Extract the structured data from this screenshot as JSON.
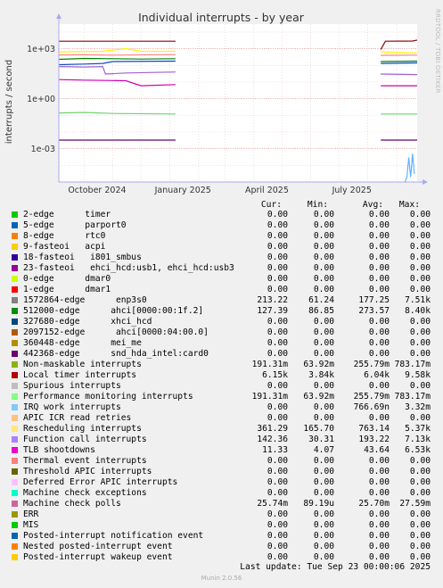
{
  "side_note": "RRDTOOL / TOBI OETIKER",
  "footer": {
    "last_update": "Last update: Tue Sep 23 00:00:06 2025",
    "version": "Munin 2.0.56"
  },
  "chart_data": {
    "type": "line",
    "title": "Individual interrupts - by year",
    "ylabel": "interrupts / second",
    "yscale": "log",
    "ylim": [
      1e-05,
      30000
    ],
    "yticks": [
      {
        "value": 0.001,
        "label": "1e-03"
      },
      {
        "value": 1,
        "label": "1e+00"
      },
      {
        "value": 1000,
        "label": "1e+03"
      }
    ],
    "xlim": [
      "2024-09-04",
      "2025-09-23"
    ],
    "xticks": [
      {
        "date": "2024-10-15",
        "label": "October 2024"
      },
      {
        "date": "2025-01-15",
        "label": "January 2025"
      },
      {
        "date": "2025-04-15",
        "label": "April 2025"
      },
      {
        "date": "2025-07-15",
        "label": "July 2025"
      }
    ],
    "grid": true,
    "series": [
      {
        "color": "#8b0000",
        "segments": [
          [
            [
              "2024-09-04",
              2800
            ],
            [
              "2025-01-07",
              2800
            ]
          ],
          [
            [
              "2025-08-15",
              900
            ],
            [
              "2025-08-20",
              2800
            ],
            [
              "2025-09-18",
              2900
            ],
            [
              "2025-09-23",
              3300
            ]
          ]
        ]
      },
      {
        "color": "#fff200",
        "segments": [
          [
            [
              "2024-09-04",
              650
            ],
            [
              "2024-10-20",
              700
            ],
            [
              "2024-11-15",
              1000
            ],
            [
              "2024-12-01",
              720
            ],
            [
              "2025-01-07",
              700
            ]
          ],
          [
            [
              "2025-08-15",
              650
            ],
            [
              "2025-09-23",
              560
            ]
          ]
        ]
      },
      {
        "color": "#ff7f7f",
        "segments": [
          [
            [
              "2024-09-04",
              420
            ],
            [
              "2024-10-01",
              430
            ],
            [
              "2024-11-01",
              410
            ],
            [
              "2025-01-07",
              440
            ]
          ],
          [
            [
              "2025-08-15",
              400
            ],
            [
              "2025-09-23",
              410
            ]
          ]
        ]
      },
      {
        "color": "#008000",
        "segments": [
          [
            [
              "2024-09-04",
              230
            ],
            [
              "2024-10-01",
              260
            ],
            [
              "2024-11-01",
              250
            ],
            [
              "2024-12-01",
              240
            ],
            [
              "2025-01-07",
              250
            ]
          ],
          [
            [
              "2025-08-15",
              170
            ],
            [
              "2025-09-23",
              180
            ]
          ]
        ]
      },
      {
        "color": "#0d4bb8",
        "segments": [
          [
            [
              "2024-09-04",
              110
            ],
            [
              "2024-10-01",
              120
            ],
            [
              "2024-10-21",
              130
            ],
            [
              "2024-10-24",
              140
            ],
            [
              "2024-11-01",
              170
            ],
            [
              "2025-01-07",
              180
            ]
          ],
          [
            [
              "2025-08-15",
              130
            ],
            [
              "2025-09-23",
              140
            ]
          ]
        ]
      },
      {
        "color": "#a05fd0",
        "segments": [
          [
            [
              "2024-09-04",
              85
            ],
            [
              "2024-10-01",
              80
            ],
            [
              "2024-10-21",
              85
            ],
            [
              "2024-10-24",
              30
            ],
            [
              "2024-11-15",
              35
            ],
            [
              "2025-01-07",
              40
            ]
          ],
          [
            [
              "2025-08-15",
              30
            ],
            [
              "2025-09-23",
              28
            ]
          ]
        ]
      },
      {
        "color": "#cc00aa",
        "segments": [
          [
            [
              "2024-09-04",
              14
            ],
            [
              "2024-10-01",
              13
            ],
            [
              "2024-11-15",
              12
            ],
            [
              "2024-12-01",
              6
            ],
            [
              "2025-01-07",
              7
            ]
          ],
          [
            [
              "2025-08-15",
              6
            ],
            [
              "2025-09-23",
              6
            ]
          ]
        ]
      },
      {
        "color": "#6fd16f",
        "segments": [
          [
            [
              "2024-09-04",
              0.14
            ],
            [
              "2024-10-01",
              0.15
            ],
            [
              "2024-11-01",
              0.13
            ],
            [
              "2025-01-07",
              0.12
            ]
          ],
          [
            [
              "2025-08-15",
              0.12
            ],
            [
              "2025-09-23",
              0.12
            ]
          ]
        ]
      },
      {
        "color": "#6b006b",
        "segments": [
          [
            [
              "2024-09-04",
              0.0033
            ],
            [
              "2025-01-07",
              0.0033
            ]
          ],
          [
            [
              "2025-08-15",
              0.0033
            ],
            [
              "2025-09-23",
              0.0033
            ]
          ]
        ]
      },
      {
        "color": "#5fb3ff",
        "segments": [
          [
            [
              "2025-09-10",
              1e-05
            ],
            [
              "2025-09-12",
              2e-05
            ],
            [
              "2025-09-14",
              0.0003
            ],
            [
              "2025-09-16",
              2e-05
            ],
            [
              "2025-09-18",
              0.0005
            ],
            [
              "2025-09-20",
              3e-05
            ]
          ]
        ]
      }
    ],
    "legend_headers": {
      "cur": "Cur:",
      "min": "Min:",
      "avg": "Avg:",
      "max": "Max:"
    },
    "legend": [
      {
        "name": "2-edge      timer",
        "color": "#00cc00",
        "cur": "0.00",
        "min": "0.00",
        "avg": "0.00",
        "max": "0.00"
      },
      {
        "name": "5-edge      parport0",
        "color": "#0066b3",
        "cur": "0.00",
        "min": "0.00",
        "avg": "0.00",
        "max": "0.00"
      },
      {
        "name": "8-edge      rtc0",
        "color": "#ff8000",
        "cur": "0.00",
        "min": "0.00",
        "avg": "0.00",
        "max": "0.00"
      },
      {
        "name": "9-fasteoi   acpi",
        "color": "#ffcc00",
        "cur": "0.00",
        "min": "0.00",
        "avg": "0.00",
        "max": "0.00"
      },
      {
        "name": "18-fasteoi   i801_smbus",
        "color": "#330099",
        "cur": "0.00",
        "min": "0.00",
        "avg": "0.00",
        "max": "0.00"
      },
      {
        "name": "23-fasteoi   ehci_hcd:usb1, ehci_hcd:usb3",
        "color": "#990099",
        "cur": "0.00",
        "min": "0.00",
        "avg": "0.00",
        "max": "0.00"
      },
      {
        "name": "0-edge      dmar0",
        "color": "#ccff00",
        "cur": "0.00",
        "min": "0.00",
        "avg": "0.00",
        "max": "0.00"
      },
      {
        "name": "1-edge      dmar1",
        "color": "#ff0000",
        "cur": "0.00",
        "min": "0.00",
        "avg": "0.00",
        "max": "0.00"
      },
      {
        "name": "1572864-edge      enp3s0",
        "color": "#808080",
        "cur": "213.22",
        "min": "61.24",
        "avg": "177.25",
        "max": "7.51k"
      },
      {
        "name": "512000-edge      ahci[0000:00:1f.2]",
        "color": "#008f00",
        "cur": "127.39",
        "min": "86.85",
        "avg": "273.57",
        "max": "8.40k"
      },
      {
        "name": "327680-edge      xhci_hcd",
        "color": "#00487d",
        "cur": "0.00",
        "min": "0.00",
        "avg": "0.00",
        "max": "0.00"
      },
      {
        "name": "2097152-edge      ahci[0000:04:00.0]",
        "color": "#b35a00",
        "cur": "0.00",
        "min": "0.00",
        "avg": "0.00",
        "max": "0.00"
      },
      {
        "name": "360448-edge      mei_me",
        "color": "#b38f00",
        "cur": "0.00",
        "min": "0.00",
        "avg": "0.00",
        "max": "0.00"
      },
      {
        "name": "442368-edge      snd_hda_intel:card0",
        "color": "#6b006b",
        "cur": "0.00",
        "min": "0.00",
        "avg": "0.00",
        "max": "0.00"
      },
      {
        "name": "Non-maskable interrupts",
        "color": "#8fb300",
        "cur": "191.31m",
        "min": "63.92m",
        "avg": "255.79m",
        "max": "783.17m"
      },
      {
        "name": "Local timer interrupts",
        "color": "#b30000",
        "cur": "6.15k",
        "min": "3.84k",
        "avg": "6.04k",
        "max": "9.58k"
      },
      {
        "name": "Spurious interrupts",
        "color": "#bebebe",
        "cur": "0.00",
        "min": "0.00",
        "avg": "0.00",
        "max": "0.00"
      },
      {
        "name": "Performance monitoring interrupts",
        "color": "#80ff80",
        "cur": "191.31m",
        "min": "63.92m",
        "avg": "255.79m",
        "max": "783.17m"
      },
      {
        "name": "IRQ work interrupts",
        "color": "#80c9ff",
        "cur": "0.00",
        "min": "0.00",
        "avg": "766.69n",
        "max": "3.32m"
      },
      {
        "name": "APIC ICR read retries",
        "color": "#ffc080",
        "cur": "0.00",
        "min": "0.00",
        "avg": "0.00",
        "max": "0.00"
      },
      {
        "name": "Rescheduling interrupts",
        "color": "#ffe680",
        "cur": "361.29",
        "min": "165.70",
        "avg": "763.14",
        "max": "5.37k"
      },
      {
        "name": "Function call interrupts",
        "color": "#aa80ff",
        "cur": "142.36",
        "min": "30.31",
        "avg": "193.22",
        "max": "7.13k"
      },
      {
        "name": "TLB shootdowns",
        "color": "#ee00cc",
        "cur": "11.33",
        "min": "4.07",
        "avg": "43.64",
        "max": "6.53k"
      },
      {
        "name": "Thermal event interrupts",
        "color": "#ff8080",
        "cur": "0.00",
        "min": "0.00",
        "avg": "0.00",
        "max": "0.00"
      },
      {
        "name": "Threshold APIC interrupts",
        "color": "#666600",
        "cur": "0.00",
        "min": "0.00",
        "avg": "0.00",
        "max": "0.00"
      },
      {
        "name": "Deferred Error APIC interrupts",
        "color": "#ffbfff",
        "cur": "0.00",
        "min": "0.00",
        "avg": "0.00",
        "max": "0.00"
      },
      {
        "name": "Machine check exceptions",
        "color": "#00ffcc",
        "cur": "0.00",
        "min": "0.00",
        "avg": "0.00",
        "max": "0.00"
      },
      {
        "name": "Machine check polls",
        "color": "#cc6699",
        "cur": "25.74m",
        "min": "89.19u",
        "avg": "25.70m",
        "max": "27.59m"
      },
      {
        "name": "ERR",
        "color": "#999900",
        "cur": "0.00",
        "min": "0.00",
        "avg": "0.00",
        "max": "0.00"
      },
      {
        "name": "MIS",
        "color": "#00cc00",
        "cur": "0.00",
        "min": "0.00",
        "avg": "0.00",
        "max": "0.00"
      },
      {
        "name": "Posted-interrupt notification event",
        "color": "#0066b3",
        "cur": "0.00",
        "min": "0.00",
        "avg": "0.00",
        "max": "0.00"
      },
      {
        "name": "Nested posted-interrupt event",
        "color": "#ff8000",
        "cur": "0.00",
        "min": "0.00",
        "avg": "0.00",
        "max": "0.00"
      },
      {
        "name": "Posted-interrupt wakeup event",
        "color": "#ffcc00",
        "cur": "0.00",
        "min": "0.00",
        "avg": "0.00",
        "max": "0.00"
      }
    ]
  }
}
